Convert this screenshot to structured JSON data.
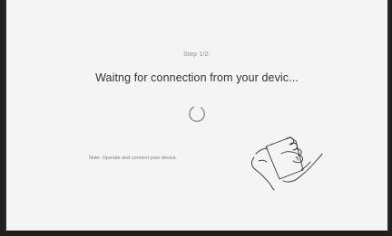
{
  "wizard": {
    "step_label": "Step 1/2:",
    "title": "Waitng for connection from your devic...",
    "note": "Note: Operate and connect your device."
  },
  "icons": {
    "spinner": "loading-spinner-icon",
    "illustration": "hand-holding-phone-icon"
  },
  "colors": {
    "background": "#f4f4f4",
    "title_text": "#333333",
    "secondary_text": "#8c8c8c",
    "frame": "#1f1f1f"
  }
}
